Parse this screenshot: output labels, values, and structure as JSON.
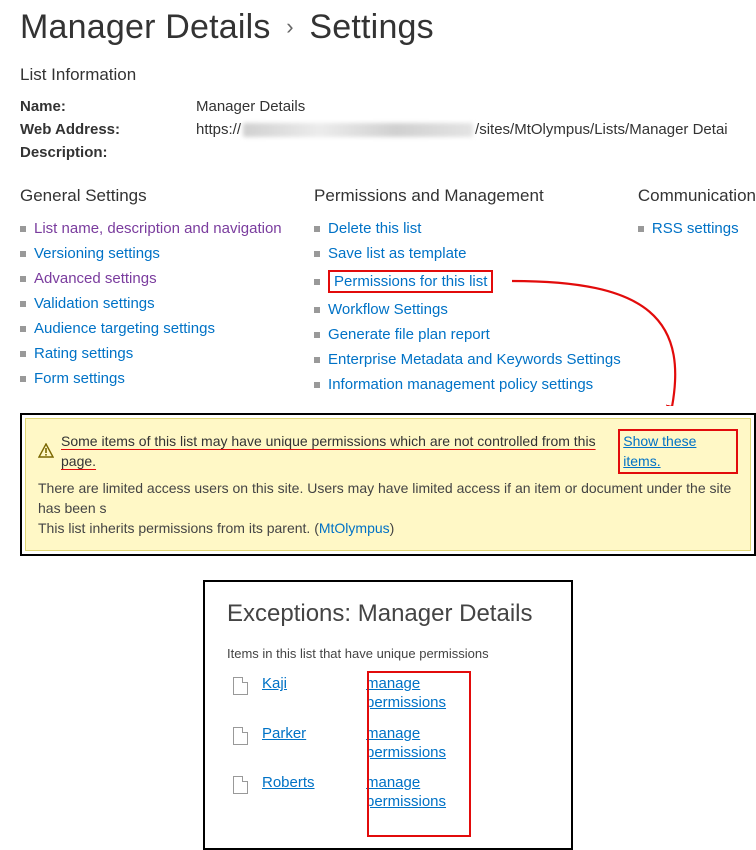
{
  "page_title_main": "Manager Details",
  "page_title_sub": "Settings",
  "info_heading": "List Information",
  "info": {
    "name_label": "Name:",
    "name_value": "Manager Details",
    "web_address_label": "Web Address:",
    "web_address_prefix": "https://",
    "web_address_suffix": "/sites/MtOlympus/Lists/Manager Detai",
    "description_label": "Description:"
  },
  "cols": {
    "general": {
      "heading": "General Settings",
      "items": [
        {
          "label": "List name, description and navigation",
          "visited": true
        },
        {
          "label": "Versioning settings",
          "visited": false
        },
        {
          "label": "Advanced settings",
          "visited": true
        },
        {
          "label": "Validation settings",
          "visited": false
        },
        {
          "label": "Audience targeting settings",
          "visited": false
        },
        {
          "label": "Rating settings",
          "visited": false
        },
        {
          "label": "Form settings",
          "visited": false
        }
      ]
    },
    "perms": {
      "heading": "Permissions and Management",
      "items": [
        {
          "label": "Delete this list"
        },
        {
          "label": "Save list as template"
        },
        {
          "label": "Permissions for this list",
          "highlight": true
        },
        {
          "label": "Workflow Settings"
        },
        {
          "label": "Generate file plan report"
        },
        {
          "label": "Enterprise Metadata and Keywords Settings"
        },
        {
          "label": "Information management policy settings"
        }
      ]
    },
    "comms": {
      "heading": "Communication",
      "items": [
        {
          "label": "RSS settings"
        }
      ]
    }
  },
  "banner": {
    "warn_text": "Some items of this list may have unique permissions which are not controlled from this page.",
    "show_link": "Show these items.",
    "line2": "There are limited access users on this site. Users may have limited access if an item or document under the site has been s",
    "line3a": "This list inherits permissions from its parent. (",
    "line3_parent": "MtOlympus",
    "line3b": ")"
  },
  "exceptions": {
    "title": "Exceptions: Manager Details",
    "sub": "Items in this list that have unique permissions",
    "items": [
      {
        "name": "Kaji",
        "manage": "manage permissions"
      },
      {
        "name": "Parker",
        "manage": "manage permissions"
      },
      {
        "name": "Roberts",
        "manage": "manage permissions"
      }
    ]
  }
}
